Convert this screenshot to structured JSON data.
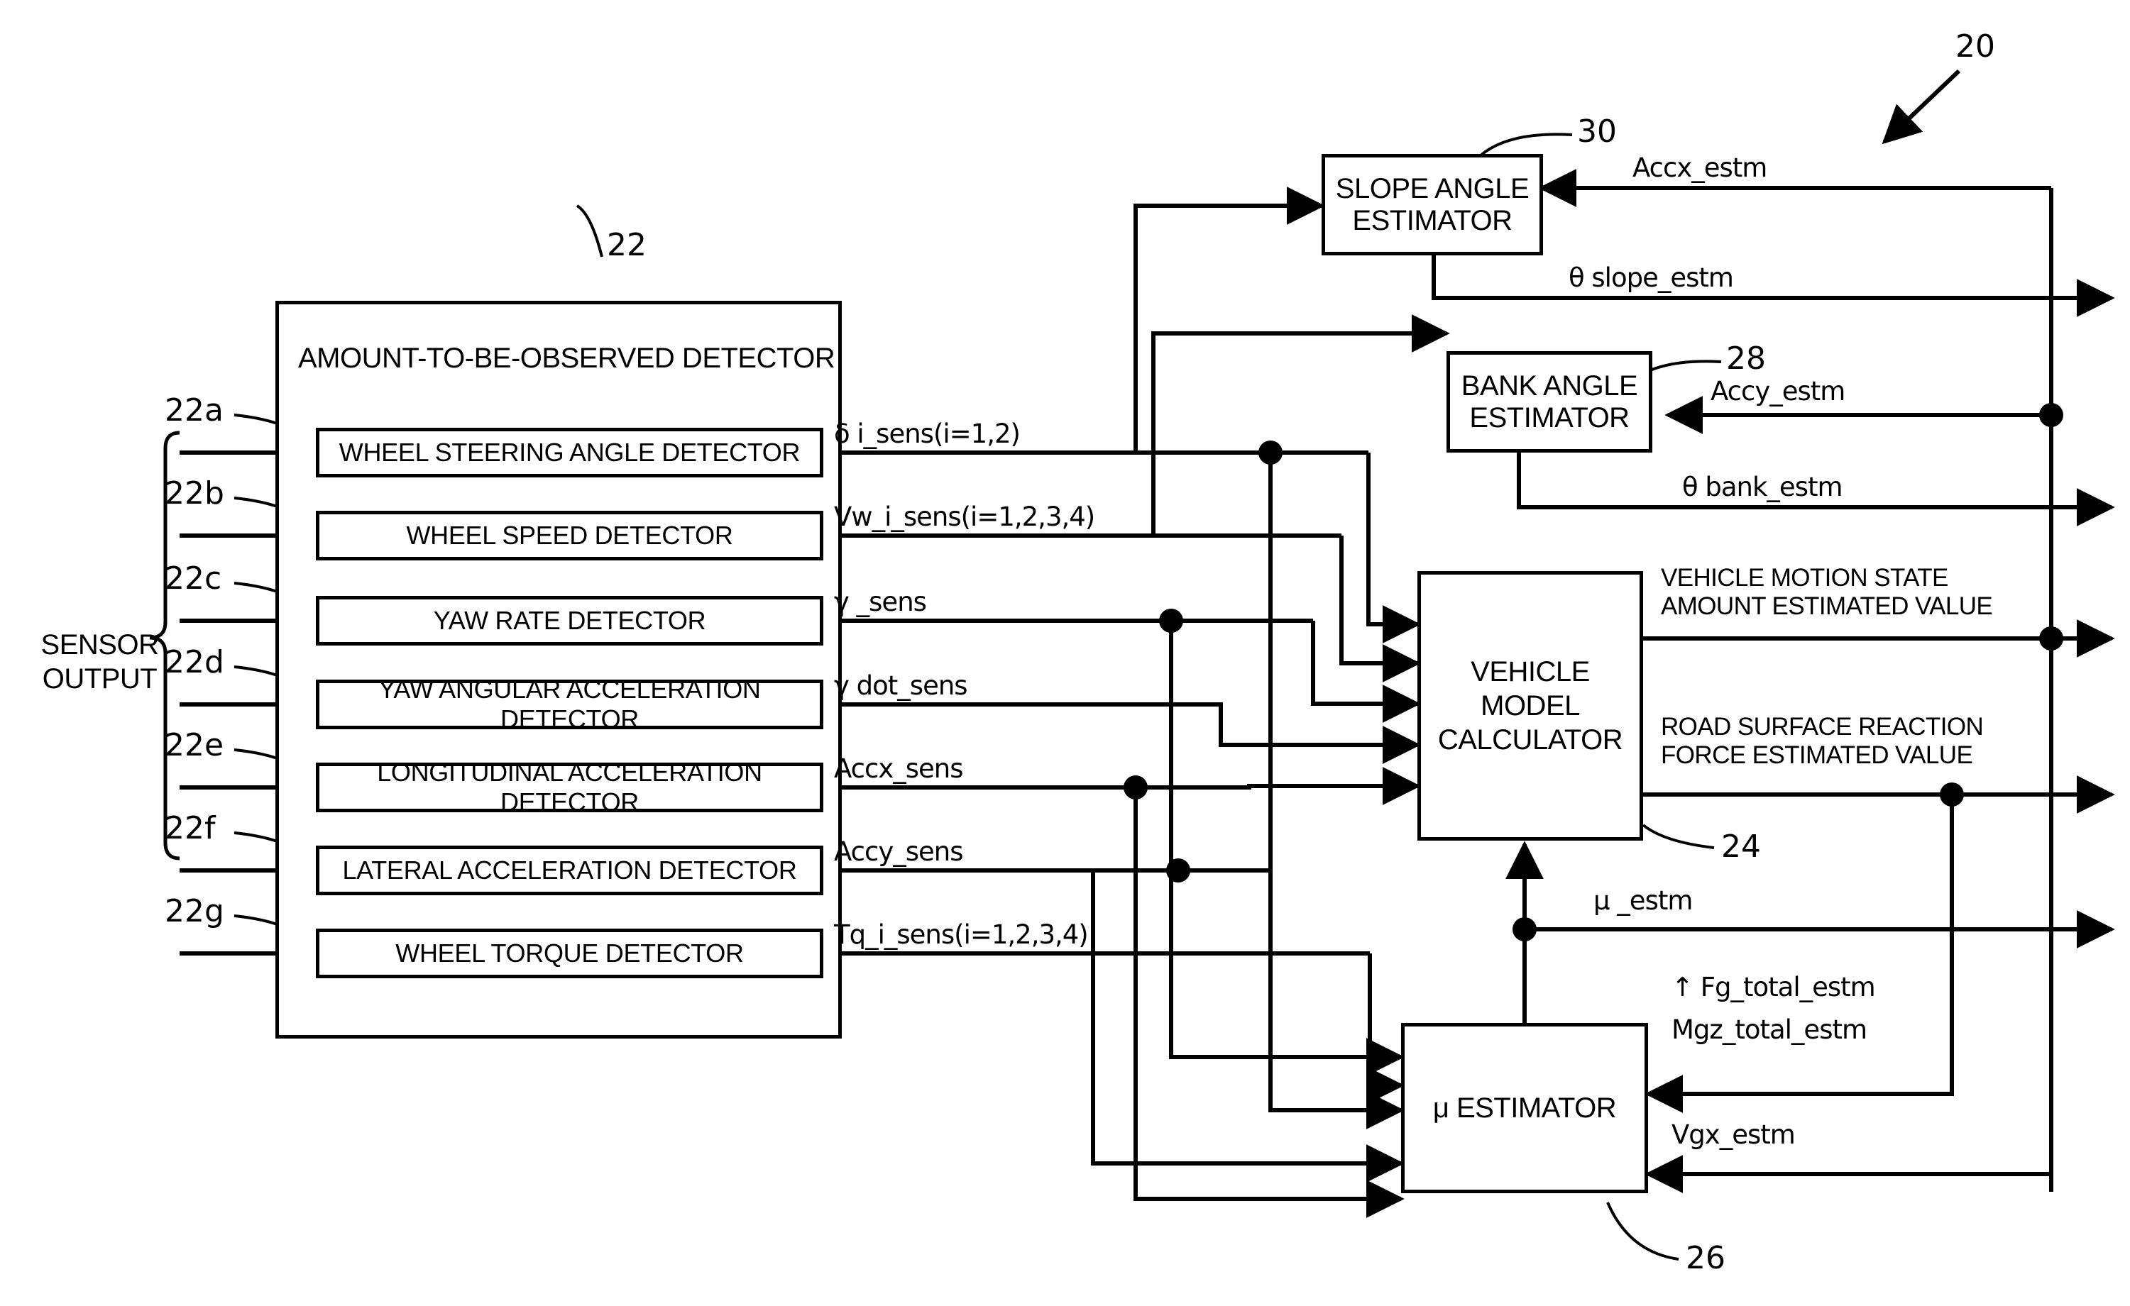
{
  "figure": {
    "refs": {
      "system": "20",
      "detector_unit": "22",
      "vehicle_model_calculator": "24",
      "mu_estimator": "26",
      "bank_angle_estimator": "28",
      "slope_angle_estimator": "30"
    },
    "sensor_output_label": "SENSOR\nOUTPUT",
    "detector_unit_title": "AMOUNT-TO-BE-OBSERVED DETECTOR",
    "detectors": [
      {
        "ref": "22a",
        "label": "WHEEL STEERING ANGLE DETECTOR",
        "signal": "δ i_sens(i=1,2)"
      },
      {
        "ref": "22b",
        "label": "WHEEL SPEED DETECTOR",
        "signal": "Vw_i_sens(i=1,2,3,4)"
      },
      {
        "ref": "22c",
        "label": "YAW RATE DETECTOR",
        "signal": "γ _sens"
      },
      {
        "ref": "22d",
        "label": "YAW ANGULAR ACCELERATION DETECTOR",
        "signal": "γ dot_sens"
      },
      {
        "ref": "22e",
        "label": "LONGITUDINAL ACCELERATION DETECTOR",
        "signal": "Accx_sens"
      },
      {
        "ref": "22f",
        "label": "LATERAL ACCELERATION DETECTOR",
        "signal": "Accy_sens"
      },
      {
        "ref": "22g",
        "label": "WHEEL TORQUE DETECTOR",
        "signal": "Tq_i_sens(i=1,2,3,4)"
      }
    ],
    "blocks": {
      "slope_angle_estimator": "SLOPE ANGLE\nESTIMATOR",
      "bank_angle_estimator": "BANK ANGLE\nESTIMATOR",
      "vehicle_model_calculator": "VEHICLE MODEL\nCALCULATOR",
      "mu_estimator": "μ ESTIMATOR"
    },
    "feedback_signals": {
      "accx_estm": "Accx_estm",
      "theta_slope_estm": "θ slope_estm",
      "accy_estm": "Accy_estm",
      "theta_bank_estm": "θ bank_estm",
      "mu_estm": "μ _estm",
      "fg_total_estm": "↑ Fg_total_estm",
      "mgz_total_estm": "Mgz_total_estm",
      "vgx_estm": "Vgx_estm"
    },
    "outputs": {
      "vehicle_motion_state": "VEHICLE MOTION STATE\nAMOUNT ESTIMATED VALUE",
      "road_surface_reaction": "ROAD SURFACE REACTION\nFORCE ESTIMATED VALUE"
    },
    "colors": {
      "line": "#000000",
      "background": "#ffffff"
    }
  }
}
